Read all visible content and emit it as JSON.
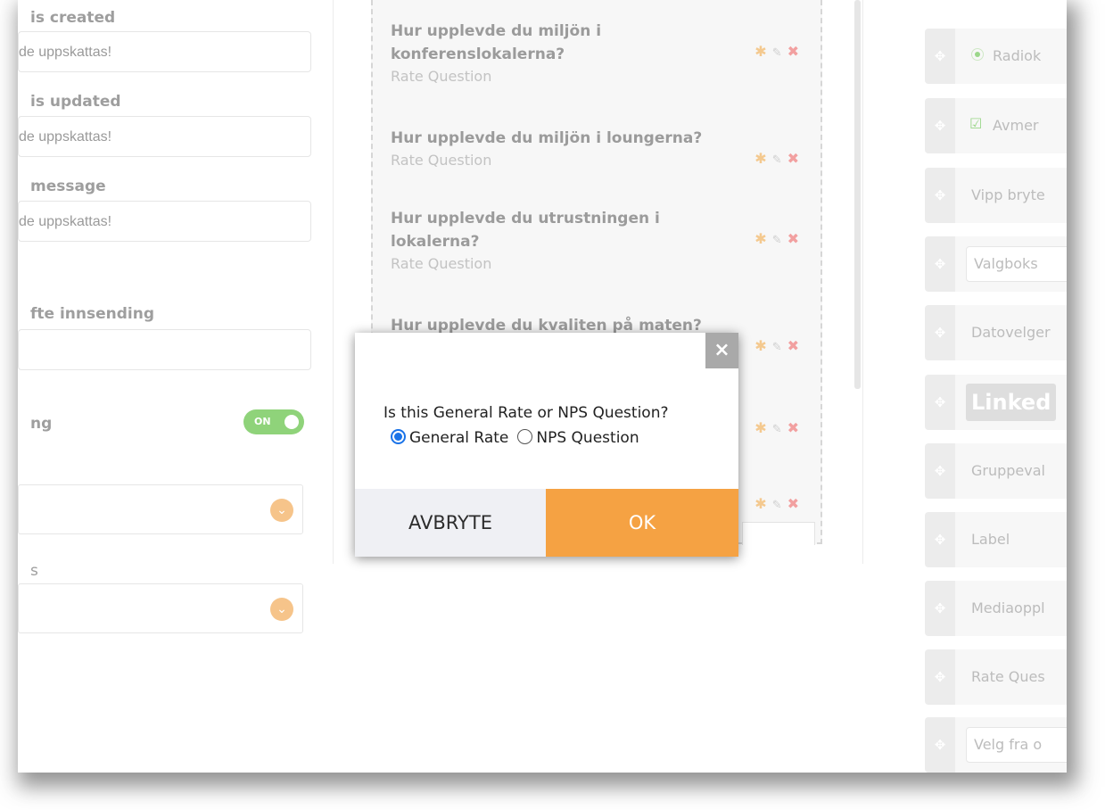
{
  "left": {
    "created_label": "is created",
    "created_value": "de uppskattas!",
    "updated_label": "is updated",
    "updated_value": "de uppskattas!",
    "message_label": "message",
    "message_value": "de uppskattas!",
    "submit_label": "fte innsending",
    "toggle_row_label": "ng",
    "toggle_on": "ON",
    "last_label": "s"
  },
  "middle": {
    "questions": [
      {
        "title": "Hur upplevde du miljön i konferenslokalerna?",
        "type": "Rate Question"
      },
      {
        "title": "Hur upplevde du miljön i loungerna?",
        "type": "Rate Question"
      },
      {
        "title": "Hur upplevde du utrustningen i lokalerna?",
        "type": "Rate Question"
      },
      {
        "title": "Hur upplevde du kvaliten på maten?",
        "type": ""
      }
    ]
  },
  "palette": {
    "items": [
      {
        "label": "Radiok",
        "icon": "radio-icon"
      },
      {
        "label": "Avmer",
        "icon": "checkbox-icon"
      },
      {
        "label": "Vipp bryte",
        "icon": ""
      },
      {
        "label": "Valgboks",
        "icon": ""
      },
      {
        "label": "Datovelger",
        "icon": ""
      },
      {
        "label": "Linked",
        "icon": "linkedin-icon"
      },
      {
        "label": "Gruppeval",
        "icon": ""
      },
      {
        "label": "Label",
        "icon": ""
      },
      {
        "label": "Mediaoppl",
        "icon": ""
      },
      {
        "label": "Rate Ques",
        "icon": ""
      },
      {
        "label": "Velg fra o",
        "icon": ""
      }
    ]
  },
  "modal": {
    "question": "Is this General Rate or NPS Question?",
    "option_general": "General Rate",
    "option_nps": "NPS Question",
    "selected": "General Rate",
    "cancel_label": "AVBRYTE",
    "ok_label": "OK",
    "close_glyph": "×"
  },
  "colors": {
    "accent_orange": "#f5a243",
    "toggle_green": "#8fd37a",
    "radio_blue": "#1a73e8"
  }
}
